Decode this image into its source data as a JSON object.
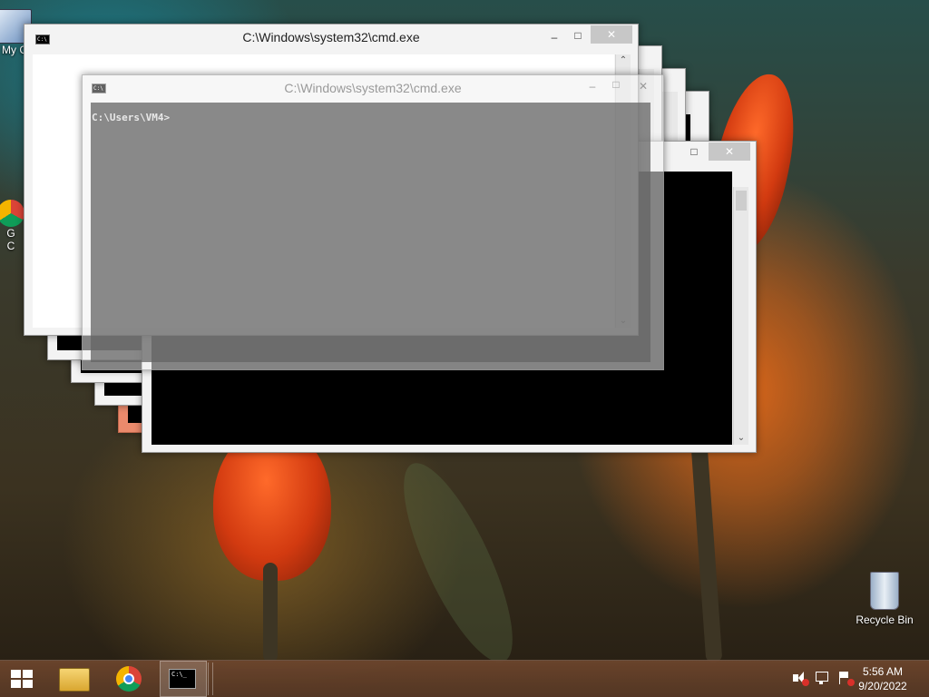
{
  "desktop": {
    "icons": [
      {
        "name": "my-computer",
        "label": "My C"
      },
      {
        "name": "google-chrome",
        "label_line1": "G",
        "label_line2": "C"
      },
      {
        "name": "recycle-bin",
        "label": "Recycle Bin"
      }
    ]
  },
  "windows": {
    "front": {
      "title": "C:\\Windows\\system32\\cmd.exe",
      "minimize": "–",
      "maximize": "□",
      "close": "✕"
    },
    "ghost": {
      "title": "C:\\Windows\\system32\\cmd.exe",
      "prompt": "C:\\Users\\VM4>",
      "minimize": "–",
      "maximize": "□",
      "close": "✕"
    },
    "back": {
      "maximize": "□",
      "close": "✕"
    }
  },
  "taskbar": {
    "start_icon": "windows-logo-icon",
    "pinned": [
      "file-explorer-icon",
      "chrome-icon",
      "cmd-icon"
    ],
    "tray": [
      "volume-muted-icon",
      "network-icon",
      "action-center-flag-icon"
    ],
    "time": "5:56 AM",
    "date": "9/20/2022"
  },
  "colors": {
    "console_bg": "#000000",
    "window_frame": "#f3f3f3",
    "close_button": "#c7c7c7",
    "taskbar": "#6e462d"
  }
}
